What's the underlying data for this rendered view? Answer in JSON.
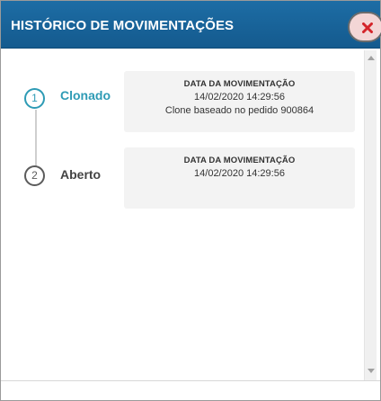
{
  "dialog": {
    "title": "HISTÓRICO DE MOVIMENTAÇÕES",
    "close_icon": "close-x-icon"
  },
  "colors": {
    "titlebar": "#1a659c",
    "accent": "#2e9bb5",
    "close_x": "#d4242a"
  },
  "steps": [
    {
      "number": "1",
      "label": "Clonado",
      "card_title": "DATA DA MOVIMENTAÇÃO",
      "date": "14/02/2020 14:29:56",
      "note": "Clone baseado no pedido 900864"
    },
    {
      "number": "2",
      "label": "Aberto",
      "card_title": "DATA DA MOVIMENTAÇÃO",
      "date": "14/02/2020 14:29:56"
    }
  ]
}
